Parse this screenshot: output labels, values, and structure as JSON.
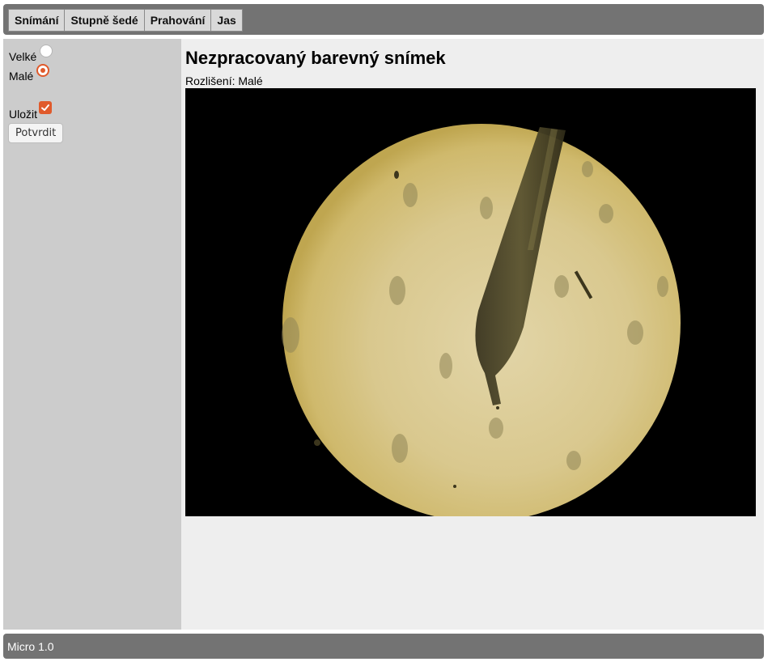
{
  "nav": {
    "tabs": [
      {
        "label": "Snímání"
      },
      {
        "label": "Stupně šedé"
      },
      {
        "label": "Prahování"
      },
      {
        "label": "Jas"
      }
    ]
  },
  "sidebar": {
    "resolution_options": [
      {
        "label": "Velké",
        "selected": false
      },
      {
        "label": "Malé",
        "selected": true
      }
    ],
    "save_label": "Uložit",
    "save_checked": true,
    "confirm_label": "Potvrdit",
    "accent_color": "#e05a2b"
  },
  "main": {
    "title": "Nezpracovaný barevný snímek",
    "resolution_text": "Rozlišení: Malé"
  },
  "footer": {
    "text": "Micro 1.0"
  }
}
